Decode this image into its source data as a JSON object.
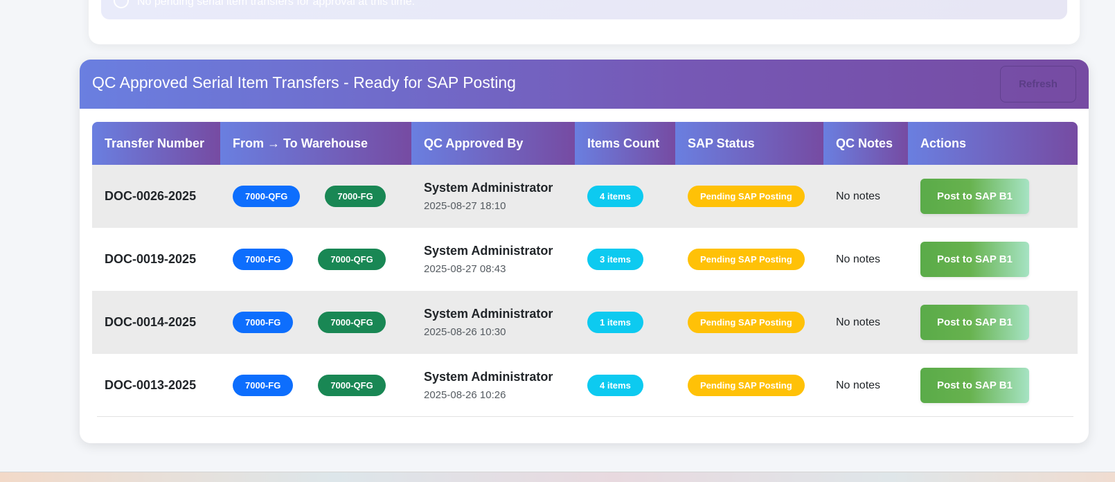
{
  "top_alert": {
    "message": "No pending serial item transfers for approval at this time."
  },
  "card": {
    "title": "QC Approved Serial Item Transfers - Ready for SAP Posting",
    "refresh_label": "Refresh"
  },
  "table": {
    "headers": [
      "Transfer Number",
      "From → To Warehouse",
      "QC Approved By",
      "Items Count",
      "SAP Status",
      "QC Notes",
      "Actions"
    ],
    "rows": [
      {
        "transfer_number": "DOC-0026-2025",
        "from": "7000-QFG",
        "to": "7000-FG",
        "approved_by": "System Administrator",
        "approved_at": "2025-08-27 18:10",
        "items_count": "4 items",
        "sap_status": "Pending SAP Posting",
        "qc_notes": "No notes",
        "action_label": "Post to SAP B1"
      },
      {
        "transfer_number": "DOC-0019-2025",
        "from": "7000-FG",
        "to": "7000-QFG",
        "approved_by": "System Administrator",
        "approved_at": "2025-08-27 08:43",
        "items_count": "3 items",
        "sap_status": "Pending SAP Posting",
        "qc_notes": "No notes",
        "action_label": "Post to SAP B1"
      },
      {
        "transfer_number": "DOC-0014-2025",
        "from": "7000-FG",
        "to": "7000-QFG",
        "approved_by": "System Administrator",
        "approved_at": "2025-08-26 10:30",
        "items_count": "1 items",
        "sap_status": "Pending SAP Posting",
        "qc_notes": "No notes",
        "action_label": "Post to SAP B1"
      },
      {
        "transfer_number": "DOC-0013-2025",
        "from": "7000-FG",
        "to": "7000-QFG",
        "approved_by": "System Administrator",
        "approved_at": "2025-08-26 10:26",
        "items_count": "4 items",
        "sap_status": "Pending SAP Posting",
        "qc_notes": "No notes",
        "action_label": "Post to SAP B1"
      }
    ]
  },
  "colors": {
    "header_gradient_start": "#6a7fe0",
    "header_gradient_end": "#764ba2",
    "from_badge": "#0d6efd",
    "to_badge": "#198754",
    "items_badge": "#0dcaf0",
    "sap_status_badge": "#ffc107",
    "post_button": "#5aab49"
  },
  "icons": {
    "alert_icon": "info-circle-icon"
  }
}
